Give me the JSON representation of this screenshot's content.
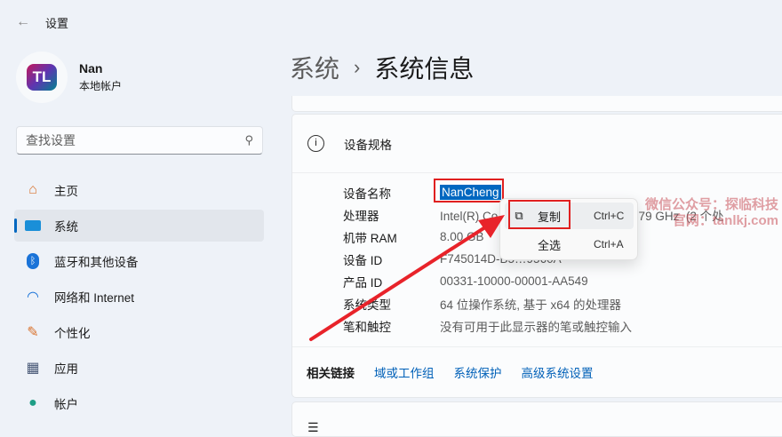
{
  "window": {
    "title": "设置",
    "back_icon": "arrow-left-icon"
  },
  "profile": {
    "name": "Nan",
    "type": "本地帐户",
    "avatar_text": "TL"
  },
  "search": {
    "placeholder": "查找设置"
  },
  "nav": [
    {
      "label": "主页",
      "icon": "home-icon"
    },
    {
      "label": "系统",
      "icon": "system-icon",
      "active": true
    },
    {
      "label": "蓝牙和其他设备",
      "icon": "bluetooth-icon"
    },
    {
      "label": "网络和 Internet",
      "icon": "wifi-icon"
    },
    {
      "label": "个性化",
      "icon": "brush-icon"
    },
    {
      "label": "应用",
      "icon": "apps-icon"
    },
    {
      "label": "帐户",
      "icon": "account-icon"
    }
  ],
  "breadcrumb": {
    "parent": "系统",
    "sep": "›",
    "current": "系统信息"
  },
  "specs": {
    "title": "设备规格",
    "rows": [
      {
        "k": "设备名称",
        "v": "NanCheng"
      },
      {
        "k": "处理器",
        "v": "Intel(R) Co                        .80GHz   3.79 GHz  (2 个处"
      },
      {
        "k": "机带 RAM",
        "v": "8.00 GB"
      },
      {
        "k": "设备 ID",
        "v": "F745014D-B5…9560A"
      },
      {
        "k": "产品 ID",
        "v": "00331-10000-00001-AA549"
      },
      {
        "k": "系统类型",
        "v": "64 位操作系统, 基于 x64 的处理器"
      },
      {
        "k": "笔和触控",
        "v": "没有可用于此显示器的笔或触控输入"
      }
    ]
  },
  "context_menu": [
    {
      "label": "复制",
      "shortcut": "Ctrl+C",
      "icon": "copy-icon"
    },
    {
      "label": "全选",
      "shortcut": "Ctrl+A"
    }
  ],
  "watermark": {
    "line1": "微信公众号：探临科技",
    "line2": "官网：tanlkj.com"
  },
  "related": {
    "title": "相关链接",
    "links": [
      "域或工作组",
      "系统保护",
      "高级系统设置"
    ]
  }
}
